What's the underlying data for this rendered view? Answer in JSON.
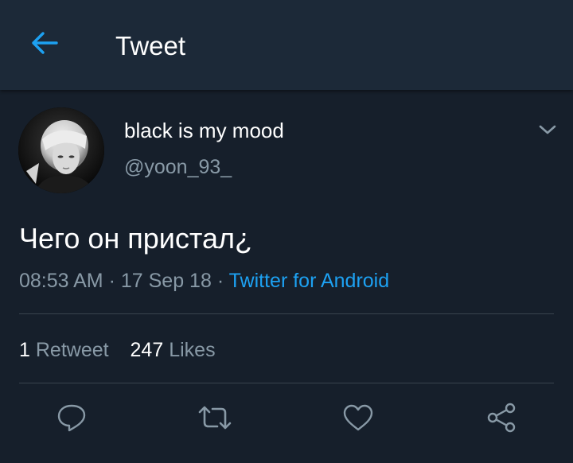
{
  "header": {
    "title": "Tweet",
    "back_icon": "back-arrow-icon"
  },
  "tweet": {
    "display_name": "black is my mood",
    "handle": "@yoon_93_",
    "text": "Чего он пристал¿",
    "time": "08:53 AM",
    "date": "17 Sep 18",
    "separator": "·",
    "source": "Twitter for Android",
    "retweets_count": "1",
    "retweets_label": "Retweet",
    "likes_count": "247",
    "likes_label": "Likes"
  },
  "actions": [
    {
      "icon": "reply-icon"
    },
    {
      "icon": "retweet-icon"
    },
    {
      "icon": "like-icon"
    },
    {
      "icon": "share-icon"
    }
  ],
  "colors": {
    "background": "#161f2b",
    "header": "#1c2938",
    "accent": "#1da1f2",
    "secondary_text": "#8899a6",
    "divider": "#38444d"
  }
}
